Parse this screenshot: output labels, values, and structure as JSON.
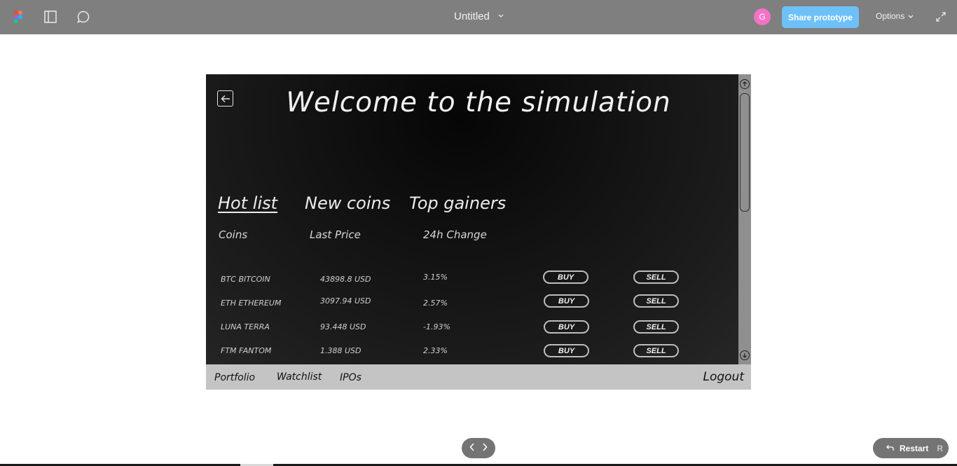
{
  "toolbar": {
    "title": "Untitled",
    "avatar_initial": "G",
    "share_label": "Share prototype",
    "options_label": "Options",
    "icons": [
      "figma-logo-icon",
      "sidebar-panel-icon",
      "comment-icon",
      "chevron-down-icon",
      "expand-icon"
    ]
  },
  "screen": {
    "welcome": "Welcome to the simulation",
    "tabs": [
      {
        "label": "Hot list",
        "active": true
      },
      {
        "label": "New coins",
        "active": false
      },
      {
        "label": "Top gainers",
        "active": false
      }
    ],
    "columns": {
      "coins": "Coins",
      "last_price": "Last Price",
      "change": "24h Change"
    },
    "rows": [
      {
        "coin": "BTC   BITCOIN",
        "price": "43898.8 USD",
        "change": "3.15%",
        "buy": "BUY",
        "sell": "SELL"
      },
      {
        "coin": "ETH  ETHEREUM",
        "price": "3097.94 USD",
        "change": "2.57%",
        "buy": "BUY",
        "sell": "SELL"
      },
      {
        "coin": "LUNA  TERRA",
        "price": "93.448 USD",
        "change": "-1.93%",
        "buy": "BUY",
        "sell": "SELL"
      },
      {
        "coin": "FTM  FANTOM",
        "price": "1.388 USD",
        "change": "2.33%",
        "buy": "BUY",
        "sell": "SELL"
      }
    ]
  },
  "bottom_nav": {
    "portfolio": "Portfolio",
    "watchlist": "Watchlist",
    "ipos": "IPOs",
    "logout": "Logout"
  },
  "controls": {
    "restart_label": "Restart",
    "restart_key": "R"
  },
  "colors": {
    "toolbar_bg": "#7f7f7f",
    "share_button": "#6ec1f7",
    "avatar": "#f472c6",
    "bottom_nav_bg": "#c4c4c4"
  }
}
